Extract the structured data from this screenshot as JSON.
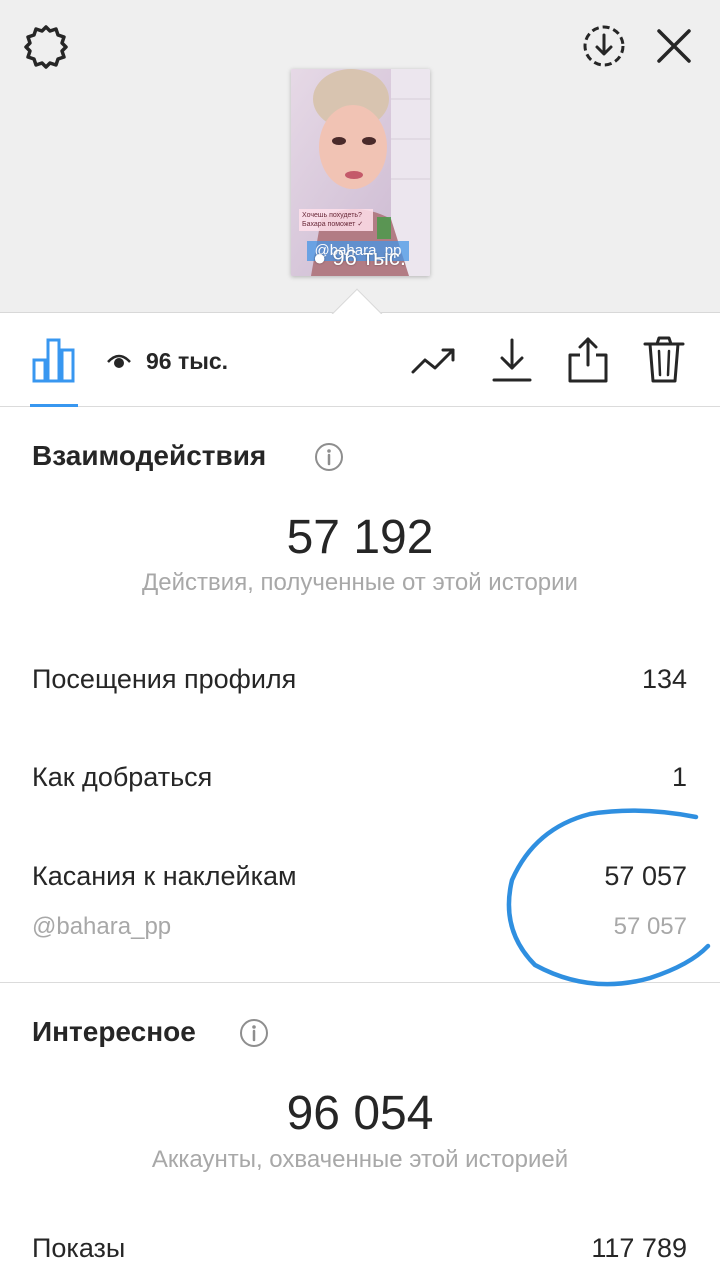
{
  "story": {
    "caption": "Хочешь похудеть? Бахара поможет ✓",
    "handle": "@bahara_pp",
    "views_overlay": "96 тыс."
  },
  "tabbar": {
    "views": "96 тыс."
  },
  "interactions": {
    "title": "Взаимодействия",
    "total": "57 192",
    "total_desc": "Действия, полученные от этой истории",
    "rows": [
      {
        "label": "Посещения профиля",
        "value": "134"
      },
      {
        "label": "Как добраться",
        "value": "1"
      },
      {
        "label": "Касания к наклейкам",
        "value": "57 057"
      }
    ],
    "sticker_sub": {
      "label": "@bahara_pp",
      "value": "57 057"
    }
  },
  "discovery": {
    "title": "Интересное",
    "total": "96 054",
    "total_desc": "Аккаунты, охваченные этой историей",
    "rows": [
      {
        "label": "Показы",
        "value": "117 789"
      }
    ]
  },
  "colors": {
    "accent": "#3897f0",
    "annotation": "#2f8fe0"
  }
}
